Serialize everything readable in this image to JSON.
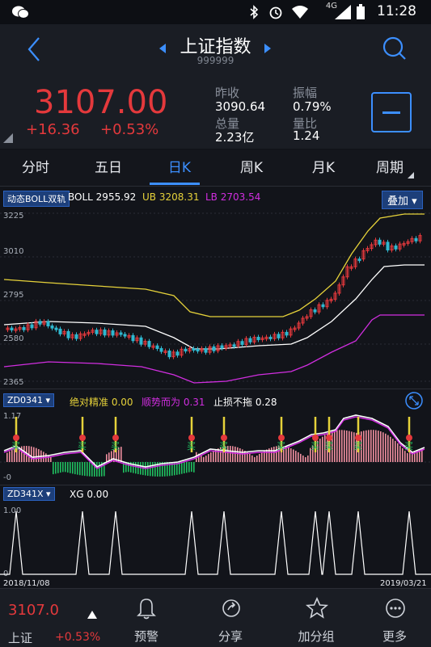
{
  "status": {
    "net": "4G",
    "time": "11:28"
  },
  "header": {
    "title": "上证指数",
    "code": "999999"
  },
  "quote": {
    "price": "3107.00",
    "change": "+16.36",
    "change_pct": "+0.53%",
    "labels": {
      "prev_close": "昨收",
      "amplitude": "振幅",
      "volume": "总量",
      "volume_ratio": "量比"
    },
    "values": {
      "prev_close": "3090.64",
      "amplitude": "0.79%",
      "volume": "2.23亿",
      "volume_ratio": "1.24"
    }
  },
  "tabs": [
    "分时",
    "五日",
    "日K",
    "周K",
    "月K",
    "周期"
  ],
  "main_chart": {
    "indicator_button": "动态BOLL双轨",
    "boll_label": "BOLL",
    "boll_value": "2955.92",
    "ub_label": "UB",
    "ub_value": "3208.31",
    "lb_label": "LB",
    "lb_value": "2703.54",
    "overlay_button": "叠加",
    "y_ticks": [
      "3225",
      "3010",
      "2795",
      "2580",
      "2365"
    ]
  },
  "sub1": {
    "button": "ZD0341",
    "label1": "绝对精准",
    "value1": "0.00",
    "label2": "顺势而为",
    "value2": "0.31",
    "label3": "止损不拖",
    "value3": "0.28",
    "y_top": "1.17",
    "y_bottom": "-0",
    "marker": "买"
  },
  "sub2": {
    "button": "ZD341X",
    "label": "XG",
    "value": "0.00",
    "y_top": "1.00",
    "y_bottom": "0",
    "date_start": "2018/11/08",
    "date_end": "2019/03/21"
  },
  "bottom": {
    "price": "3107.0",
    "name": "上证",
    "pct": "+0.53%",
    "items": [
      "预警",
      "分享",
      "加分组",
      "更多"
    ]
  },
  "colors": {
    "up": "#e4393c",
    "down": "#20c060",
    "accent": "#3c8fff",
    "ub": "#e6d23a",
    "lb": "#d12ee0",
    "boll": "#ffffff"
  }
}
